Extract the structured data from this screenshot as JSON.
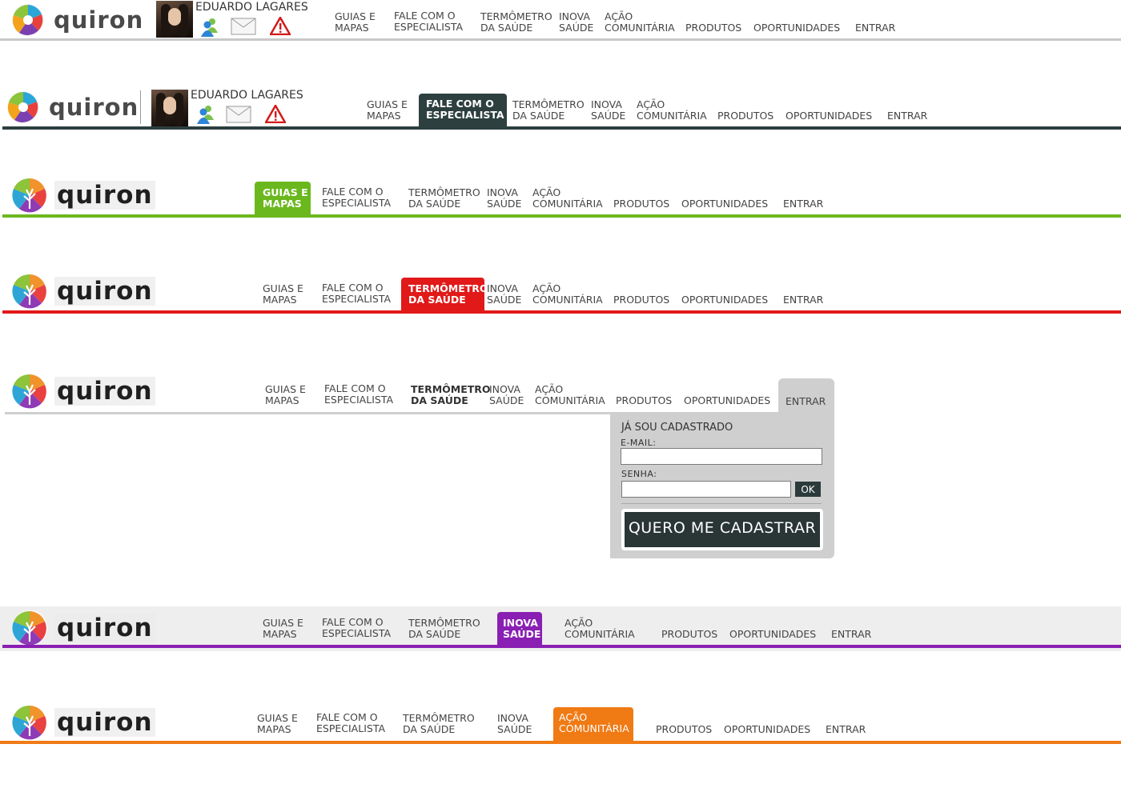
{
  "brand": {
    "name": "quiron"
  },
  "user": {
    "name": "EDUARDO LAGARES"
  },
  "nav": {
    "guias_l1": "GUIAS E",
    "guias_l2": "MAPAS",
    "fale_l1": "FALE COM O",
    "fale_l2": "ESPECIALISTA",
    "termo_l1": "TERMÔMETRO",
    "termo_l2": "DA SAÚDE",
    "inova_l1": "INOVA",
    "inova_l2": "SAÚDE",
    "acao_l1": "AÇÃO",
    "acao_l2": "COMUNITÁRIA",
    "produtos": "PRODUTOS",
    "oportunidades": "OPORTUNIDADES",
    "entrar": "ENTRAR"
  },
  "login": {
    "title": "JÁ SOU CADASTRADO",
    "email_label": "E-MAIL:",
    "password_label": "SENHA:",
    "ok_label": "OK",
    "register_label": "QUERO ME CADASTRAR"
  },
  "colors": {
    "grey_line": "#c8c8c8",
    "dark_teal": "#2d3f3f",
    "green": "#6bb81e",
    "red": "#e11919",
    "purple": "#8a1fb3",
    "orange": "#f07a14"
  }
}
